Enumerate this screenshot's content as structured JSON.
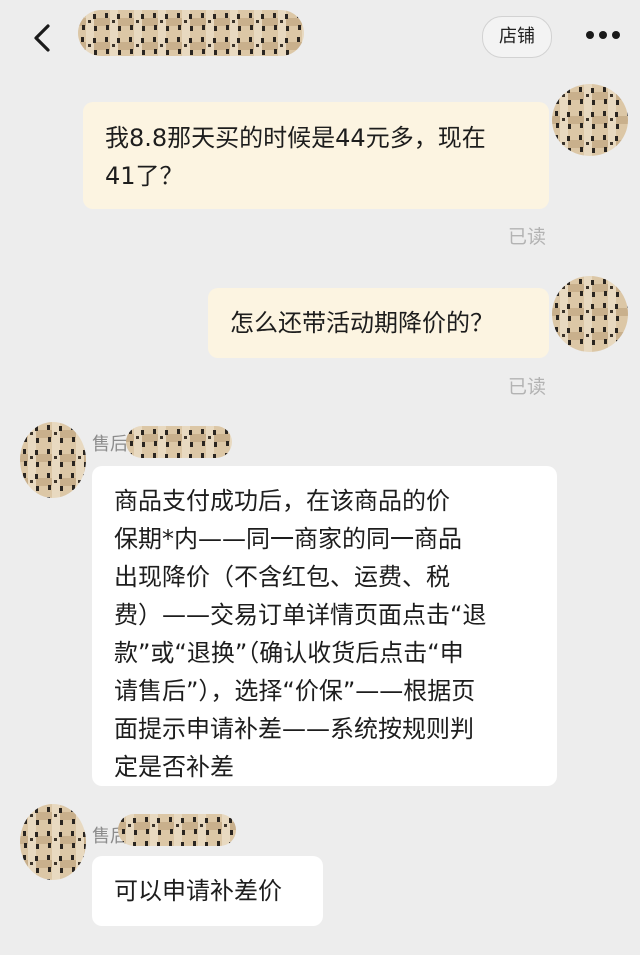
{
  "header": {
    "back_icon": "chevron-left-icon",
    "shop_label": "店铺",
    "more_icon": "more-dots-icon"
  },
  "messages": [
    {
      "side": "out",
      "text_lines": [
        "我8.8那天买的时候是44元多，现在",
        "41了？"
      ],
      "status": "已读"
    },
    {
      "side": "out",
      "text_lines": [
        "怎么还带活动期降价的？"
      ],
      "status": "已读"
    },
    {
      "side": "in",
      "sender": "售后",
      "text_lines": [
        "商品支付成功后，在该商品的价",
        "保期*内——同一商家的同一商品",
        "出现降价（不含红包、运费、税",
        "费）——交易订单详情页面点击“退",
        "款”或“退换”（确认收货后点击“申",
        "请售后”），选择“价保”——根据页",
        "面提示申请补差——系统按规则判",
        "定是否补差"
      ]
    },
    {
      "side": "in",
      "sender": "售后",
      "text_lines": [
        "可以申请补差价"
      ]
    }
  ],
  "colors": {
    "background": "#ededed",
    "outgoing_bubble": "#fcf4e1",
    "incoming_bubble": "#ffffff",
    "read_status": "#b3b3b3"
  }
}
